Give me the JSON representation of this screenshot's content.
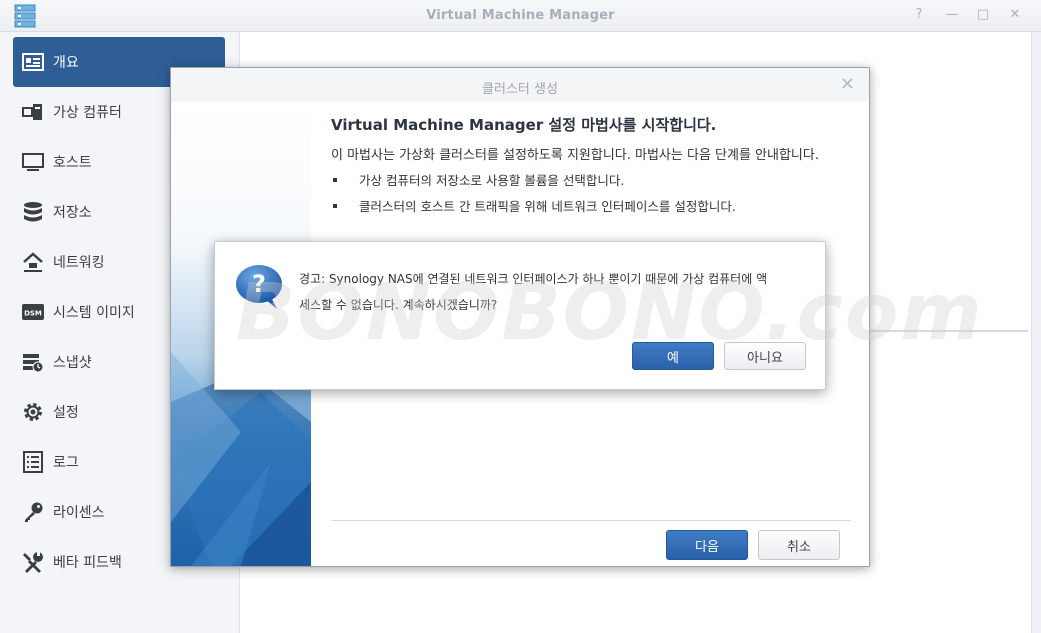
{
  "window": {
    "title": "Virtual Machine Manager",
    "controls": [
      "?",
      "—",
      "□",
      "✕"
    ]
  },
  "sidebar": {
    "items": [
      {
        "label": "개요",
        "icon": "overview-card-icon",
        "active": true
      },
      {
        "label": "가상 컴퓨터",
        "icon": "virtual-computer-icon",
        "active": false
      },
      {
        "label": "호스트",
        "icon": "monitor-icon",
        "active": false
      },
      {
        "label": "저장소",
        "icon": "database-icon",
        "active": false
      },
      {
        "label": "네트워킹",
        "icon": "network-home-icon",
        "active": false
      },
      {
        "label": "시스템 이미지",
        "icon": "dsm-image-icon",
        "active": false
      },
      {
        "label": "스냅샷",
        "icon": "snapshot-icon",
        "active": false
      },
      {
        "label": "설정",
        "icon": "gear-icon",
        "active": false
      },
      {
        "label": "로그",
        "icon": "list-icon",
        "active": false
      },
      {
        "label": "라이센스",
        "icon": "key-icon",
        "active": false
      },
      {
        "label": "베타 피드백",
        "icon": "wrench-icon",
        "active": false
      }
    ]
  },
  "wizard": {
    "title": "클러스터 생성",
    "heading": "Virtual Machine Manager 설정 마법사를 시작합니다.",
    "intro": "이 마법사는 가상화 클러스터를 설정하도록 지원합니다. 마법사는 다음 단계를 안내합니다.",
    "bullets": [
      "가상 컴퓨터의 저장소로 사용할 볼륨을 선택합니다.",
      "클러스터의 호스트 간 트래픽을 위해 네트워크 인터페이스를 설정합니다."
    ],
    "next_label": "다음",
    "cancel_label": "취소"
  },
  "alert": {
    "line1": "경고: Synology NAS에 연결된 네트워크 인터페이스가 하나 뿐이기 때문에 가상 컴퓨터에 액",
    "line2": "세스할 수 없습니다. 계속하시겠습니까?",
    "yes_label": "예",
    "no_label": "아니요"
  },
  "watermark": "BONOBONO.com",
  "colors": {
    "accent": "#2f5e96",
    "primary_button": "#3370b8"
  }
}
